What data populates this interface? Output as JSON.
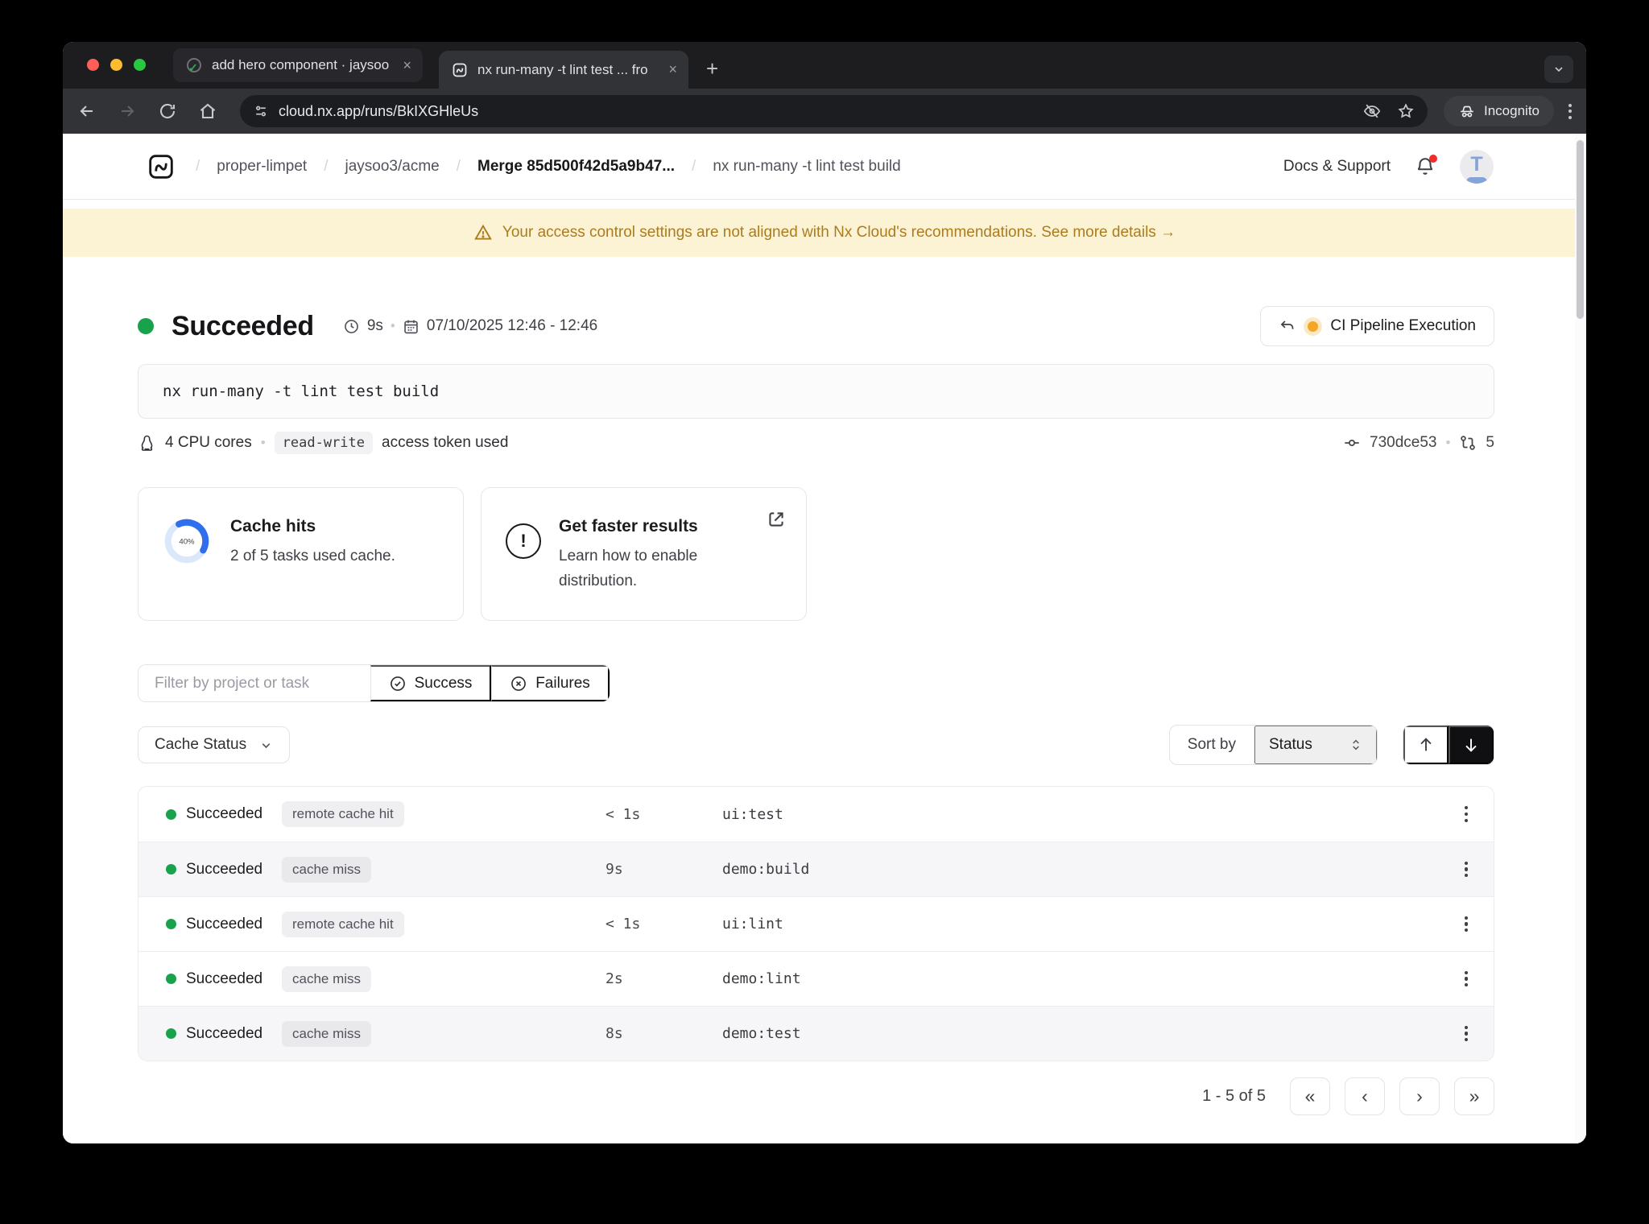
{
  "ui": {
    "dot": "•"
  },
  "colors": {
    "success_green": "#17a24b",
    "warning_amber": "#f5a623",
    "banner_bg": "#fcf3d5",
    "banner_text": "#ac7b1e",
    "accent_blue": "#2f6fed",
    "dark_button": "#101013"
  },
  "browser": {
    "tabs": [
      {
        "title": "add hero component · jaysoo",
        "close": "×"
      },
      {
        "title": "nx run-many -t lint test ... fro",
        "close": "×"
      }
    ],
    "new_tab": "+",
    "url": "cloud.nx.app/runs/BkIXGHleUs",
    "incognito_label": "Incognito"
  },
  "header": {
    "breadcrumb": [
      "proper-limpet",
      "jaysoo3/acme",
      "Merge 85d500f42d5a9b47...",
      "nx run-many -t lint test build"
    ],
    "separator": "/",
    "docs_support": "Docs & Support",
    "avatar_letter": "T"
  },
  "banner": {
    "message": "Your access control settings are not aligned with Nx Cloud's recommendations. See more details →"
  },
  "run": {
    "status": "Succeeded",
    "duration": "9s",
    "datetime": "07/10/2025 12:46 - 12:46",
    "label_button": "CI Pipeline Execution",
    "command": "nx run-many -t lint test build",
    "cpu": "4 CPU cores",
    "token_chip": "read-write",
    "token_suffix": "access token used",
    "commit": "730dce53",
    "branch_count": "5"
  },
  "cards": {
    "cache": {
      "percent_label": "40%",
      "percent_value": 40,
      "title": "Cache hits",
      "subtitle": "2 of 5 tasks used cache."
    },
    "distribution": {
      "icon_glyph": "!",
      "title": "Get faster results",
      "body": "Learn how to enable distribution."
    }
  },
  "filters": {
    "placeholder": "Filter by project or task",
    "success": "Success",
    "failures": "Failures",
    "cache_status": "Cache Status",
    "sort_by": "Sort by",
    "sort_value": "Status"
  },
  "table": {
    "rows": [
      {
        "status": "Succeeded",
        "cache": "remote cache hit",
        "duration": "< 1s",
        "task": "ui:test",
        "shaded": false
      },
      {
        "status": "Succeeded",
        "cache": "cache miss",
        "duration": "9s",
        "task": "demo:build",
        "shaded": true
      },
      {
        "status": "Succeeded",
        "cache": "remote cache hit",
        "duration": "< 1s",
        "task": "ui:lint",
        "shaded": false
      },
      {
        "status": "Succeeded",
        "cache": "cache miss",
        "duration": "2s",
        "task": "demo:lint",
        "shaded": false
      },
      {
        "status": "Succeeded",
        "cache": "cache miss",
        "duration": "8s",
        "task": "demo:test",
        "shaded": true
      }
    ]
  },
  "pagination": {
    "label": "1 - 5 of 5",
    "first": "«",
    "prev": "‹",
    "next": "›",
    "last": "»"
  }
}
